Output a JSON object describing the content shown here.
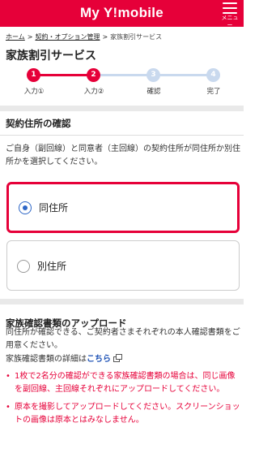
{
  "header": {
    "logo": "My Y!mobile",
    "menu_label": "メニュー",
    "color": "#e60039"
  },
  "breadcrumb": [
    {
      "label": "ホーム",
      "link": true
    },
    {
      "label": "契約・オプション管理",
      "link": true
    },
    {
      "label": "家族割引サービス",
      "link": false
    }
  ],
  "breadcrumb_separator": ">",
  "page_title": "家族割引サービス",
  "steps": [
    {
      "number": "1",
      "label": "入力①",
      "state": "done"
    },
    {
      "number": "2",
      "label": "入力②",
      "state": "current"
    },
    {
      "number": "3",
      "label": "確認",
      "state": "pending"
    },
    {
      "number": "4",
      "label": "完了",
      "state": "pending"
    }
  ],
  "section_address": {
    "title": "契約住所の確認",
    "description": "ご自身（副回線）と同意者（主回線）の契約住所が同住所か別住所かを選択してください。",
    "options": [
      {
        "label": "同住所",
        "selected": true
      },
      {
        "label": "別住所",
        "selected": false
      }
    ]
  },
  "section_upload": {
    "title": "家族確認書類のアップロード",
    "description": "同住所が確認できる、ご契約者さまそれぞれの本人確認書類をご用意ください。",
    "details_text": "家族確認書類の詳細は",
    "details_link": "こちら",
    "notes": [
      "1枚で2名分の確認ができる家族確認書類の場合は、同じ画像を副回線、主回線それぞれにアップロードしてください。",
      "原本を撮影してアップロードしてください。スクリーンショットの画像は原本とはみなしません。"
    ]
  },
  "colors": {
    "brand": "#e60039",
    "pending_step": "#c9d9ee",
    "radio": "#2d66c6",
    "link": "#1a4fb4"
  }
}
